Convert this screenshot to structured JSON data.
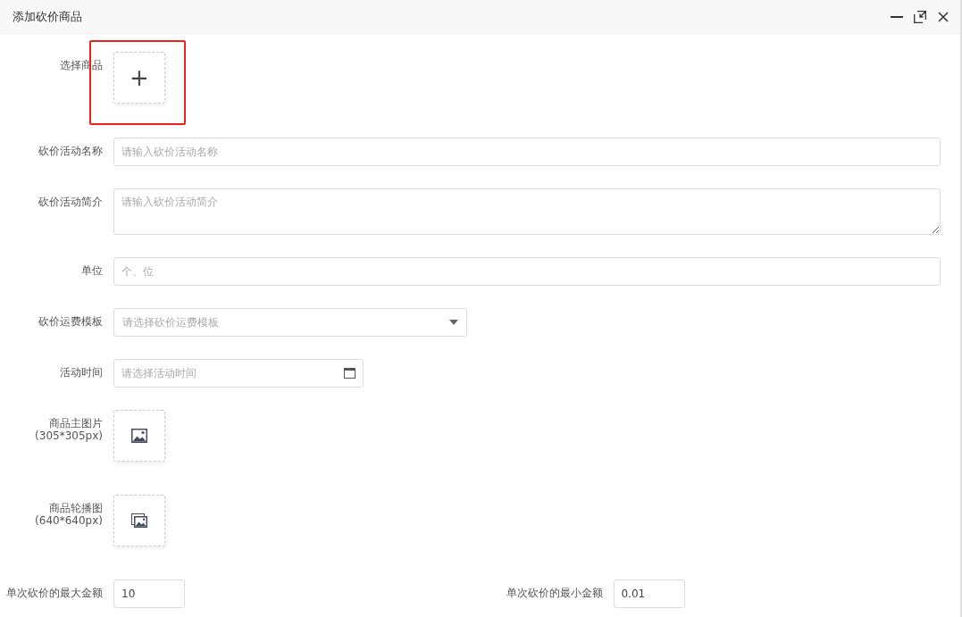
{
  "window": {
    "title": "添加砍价商品"
  },
  "fields": [
    {
      "kind": "add",
      "label": "选择商品",
      "plus": "+",
      "highlighted": true
    },
    {
      "kind": "text",
      "label": "砍价活动名称",
      "placeholder": "请输入砍价活动名称"
    },
    {
      "kind": "textarea",
      "label": "砍价活动简介",
      "placeholder": "请输入砍价活动简介"
    },
    {
      "kind": "text",
      "label": "单位",
      "placeholder": "个、位"
    },
    {
      "kind": "select",
      "label": "砍价运费模板",
      "placeholder": "请选择砍价运费模板"
    },
    {
      "kind": "date",
      "label": "活动时间",
      "placeholder": "请选择活动时间"
    },
    {
      "kind": "image",
      "label": "商品主图片",
      "note": "(305*305px)"
    },
    {
      "kind": "gallery",
      "label": "商品轮播图",
      "note": "(640*640px)"
    }
  ],
  "amounts": [
    {
      "label": "单次砍价的最大金额",
      "value": "10"
    },
    {
      "label": "单次砍价的最小金额",
      "value": "0.01"
    }
  ]
}
